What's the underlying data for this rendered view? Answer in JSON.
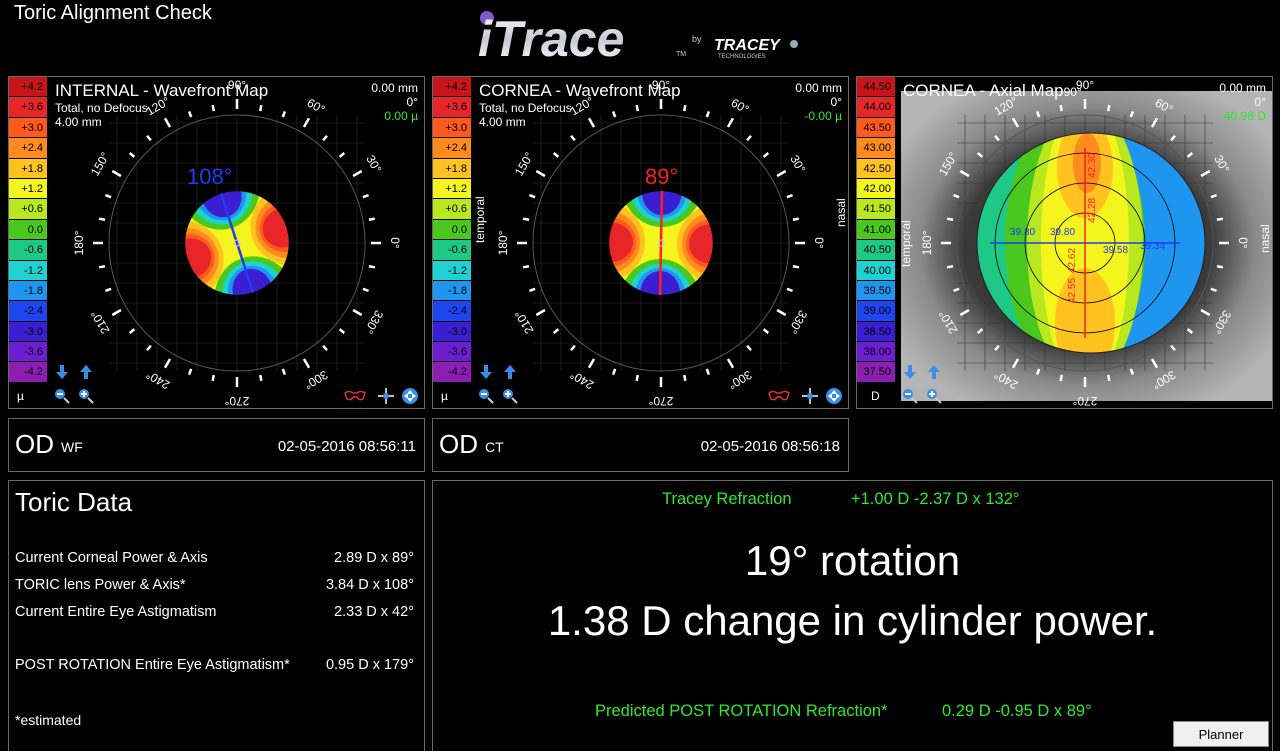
{
  "window_title": "Toric Alignment Check",
  "logo": {
    "brand": "iTrace",
    "tm": "TM",
    "by": "by",
    "company": "TRACEY",
    "company_sub": "TECHNOLOGIES"
  },
  "wavefront_scale": [
    "+4.2",
    "+3.6",
    "+3.0",
    "+2.4",
    "+1.8",
    "+1.2",
    "+0.6",
    "0.0",
    "-0.6",
    "-1.2",
    "-1.8",
    "-2.4",
    "-3.0",
    "-3.6",
    "-4.2"
  ],
  "wavefront_scale_colors": [
    "#c8151b",
    "#e8262a",
    "#ff5a1e",
    "#ff8a1e",
    "#ffc21e",
    "#f5f51e",
    "#b9e81e",
    "#4ac81e",
    "#1ec887",
    "#1ed2d2",
    "#1e96f0",
    "#1e46f0",
    "#3c1ed2",
    "#6e1ed2",
    "#8c1eb4"
  ],
  "axial_scale": [
    "44.50",
    "44.00",
    "43.50",
    "43.00",
    "42.50",
    "42.00",
    "41.50",
    "41.00",
    "40.50",
    "40.00",
    "39.50",
    "39.00",
    "38.50",
    "38.00",
    "37.50"
  ],
  "panels": {
    "internal": {
      "title": "INTERNAL - Wavefront Map",
      "sub1": "Total, no Defocus",
      "sub2": "4.00 mm",
      "r1": "0.00 mm",
      "r2": "0°",
      "r3": "0.00 µ",
      "unit": "µ",
      "axis_label": "108°",
      "axis_color": "#1e3cf0",
      "axis_deg": 108
    },
    "cornea_wf": {
      "title": "CORNEA - Wavefront Map",
      "sub1": "Total, no Defocus",
      "sub2": "4.00 mm",
      "r1": "0.00 mm",
      "r2": "0°",
      "r3": "-0.00 µ",
      "unit": "µ",
      "axis_label": "89°",
      "axis_color": "#ff1e1e",
      "axis_deg": 89,
      "temporal": "temporal",
      "nasal": "nasal"
    },
    "cornea_axial": {
      "title": "CORNEA - Axial Map",
      "title_deg": "90°",
      "r1": "0.00 mm",
      "r2": "0°",
      "r3": "40.98 D",
      "unit": "D",
      "temporal": "temporal",
      "nasal": "nasal",
      "readings": [
        "39.80",
        "39.80",
        "39.58",
        "39.34",
        "42.30",
        "42.28",
        "42.55",
        "42.62"
      ]
    }
  },
  "dial_labels": [
    "0°",
    "30°",
    "60°",
    "90°",
    "120°",
    "150°",
    "180°",
    "210°",
    "240°",
    "270°",
    "300°",
    "330°"
  ],
  "exams": [
    {
      "eye": "OD",
      "type": "WF",
      "datetime": "02-05-2016  08:56:11"
    },
    {
      "eye": "OD",
      "type": "CT",
      "datetime": "02-05-2016  08:56:18"
    }
  ],
  "toric": {
    "title": "Toric Data",
    "rows": [
      {
        "label": "Current Corneal Power & Axis",
        "value": "2.89 D x 89°"
      },
      {
        "label": "TORIC lens Power & Axis*",
        "value": "3.84 D x 108°"
      },
      {
        "label": "Current Entire Eye Astigmatism",
        "value": "2.33 D x 42°"
      },
      {
        "label": "POST ROTATION Entire Eye Astigmatism*",
        "value": "0.95 D x 179°"
      }
    ],
    "footnote": "*estimated"
  },
  "result": {
    "refraction_label": "Tracey Refraction",
    "refraction_value": "+1.00 D -2.37 D x 132°",
    "line1": "19° rotation",
    "line2": "1.38 D change in cylinder power.",
    "predicted_label": "Predicted POST ROTATION Refraction*",
    "predicted_value": "0.29 D  -0.95 D x 89°",
    "planner_button": "Planner"
  }
}
